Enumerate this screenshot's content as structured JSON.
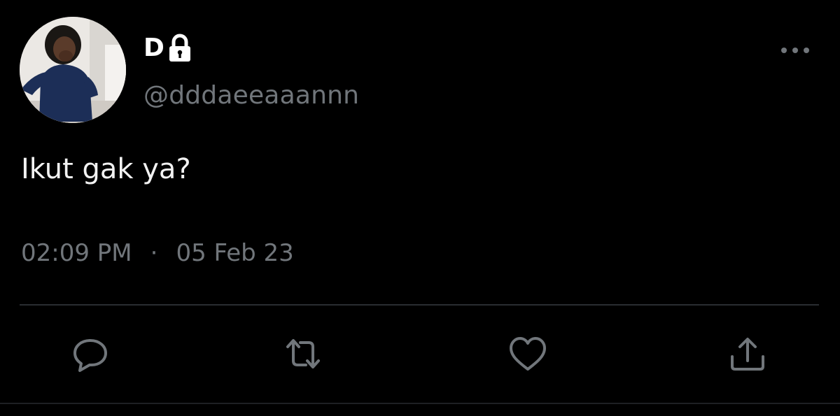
{
  "author": {
    "display_name": "D",
    "handle": "@dddaeeaaannn",
    "protected_icon": "lock-icon",
    "avatar_icon": "profile-photo"
  },
  "tweet": {
    "text": "Ikut gak ya?",
    "time": "02:09 PM",
    "separator": "·",
    "date": "05 Feb 23"
  },
  "actions": {
    "reply_icon": "reply-icon",
    "retweet_icon": "retweet-icon",
    "like_icon": "heart-icon",
    "share_icon": "share-icon",
    "more_icon": "more-icon"
  },
  "colors": {
    "background": "#000000",
    "primary_text": "#ffffff",
    "secondary_text": "#71767b",
    "divider": "#2a2d31"
  }
}
